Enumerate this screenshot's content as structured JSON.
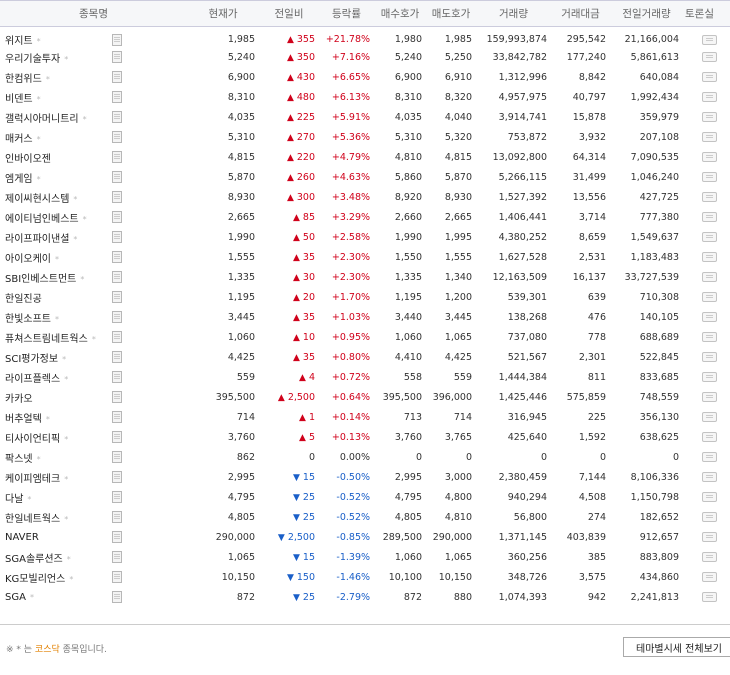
{
  "headers": {
    "name": "종목명",
    "price": "현재가",
    "change": "전일비",
    "rate": "등락률",
    "bid": "매수호가",
    "ask": "매도호가",
    "volume": "거래량",
    "amount": "거래대금",
    "prev_volume": "전일거래량",
    "talk": "토론실"
  },
  "rows": [
    {
      "name": "위지트",
      "star": "*",
      "price": "1,985",
      "dir": "up",
      "change": "355",
      "rate": "+21.78%",
      "bid": "1,980",
      "ask": "1,985",
      "volume": "159,993,874",
      "amount": "295,542",
      "prev": "21,166,004"
    },
    {
      "name": "우리기술투자",
      "star": "*",
      "price": "5,240",
      "dir": "up",
      "change": "350",
      "rate": "+7.16%",
      "bid": "5,240",
      "ask": "5,250",
      "volume": "33,842,782",
      "amount": "177,240",
      "prev": "5,861,613"
    },
    {
      "name": "한컴위드",
      "star": "*",
      "price": "6,900",
      "dir": "up",
      "change": "430",
      "rate": "+6.65%",
      "bid": "6,900",
      "ask": "6,910",
      "volume": "1,312,996",
      "amount": "8,842",
      "prev": "640,084"
    },
    {
      "name": "비덴트",
      "star": "*",
      "price": "8,310",
      "dir": "up",
      "change": "480",
      "rate": "+6.13%",
      "bid": "8,310",
      "ask": "8,320",
      "volume": "4,957,975",
      "amount": "40,797",
      "prev": "1,992,434"
    },
    {
      "name": "갤럭시아머니트리",
      "star": "*",
      "price": "4,035",
      "dir": "up",
      "change": "225",
      "rate": "+5.91%",
      "bid": "4,035",
      "ask": "4,040",
      "volume": "3,914,741",
      "amount": "15,878",
      "prev": "359,979"
    },
    {
      "name": "매커스",
      "star": "*",
      "price": "5,310",
      "dir": "up",
      "change": "270",
      "rate": "+5.36%",
      "bid": "5,310",
      "ask": "5,320",
      "volume": "753,872",
      "amount": "3,932",
      "prev": "207,108"
    },
    {
      "name": "인바이오젠",
      "star": "",
      "price": "4,815",
      "dir": "up",
      "change": "220",
      "rate": "+4.79%",
      "bid": "4,810",
      "ask": "4,815",
      "volume": "13,092,800",
      "amount": "64,314",
      "prev": "7,090,535"
    },
    {
      "name": "엠게임",
      "star": "*",
      "price": "5,870",
      "dir": "up",
      "change": "260",
      "rate": "+4.63%",
      "bid": "5,860",
      "ask": "5,870",
      "volume": "5,266,115",
      "amount": "31,499",
      "prev": "1,046,240"
    },
    {
      "name": "제이씨현시스템",
      "star": "*",
      "price": "8,930",
      "dir": "up",
      "change": "300",
      "rate": "+3.48%",
      "bid": "8,920",
      "ask": "8,930",
      "volume": "1,527,392",
      "amount": "13,556",
      "prev": "427,725"
    },
    {
      "name": "에이티넘인베스트",
      "star": "*",
      "price": "2,665",
      "dir": "up",
      "change": "85",
      "rate": "+3.29%",
      "bid": "2,660",
      "ask": "2,665",
      "volume": "1,406,441",
      "amount": "3,714",
      "prev": "777,380"
    },
    {
      "name": "라이프파이낸셜",
      "star": "*",
      "price": "1,990",
      "dir": "up",
      "change": "50",
      "rate": "+2.58%",
      "bid": "1,990",
      "ask": "1,995",
      "volume": "4,380,252",
      "amount": "8,659",
      "prev": "1,549,637"
    },
    {
      "name": "아이오케이",
      "star": "*",
      "price": "1,555",
      "dir": "up",
      "change": "35",
      "rate": "+2.30%",
      "bid": "1,550",
      "ask": "1,555",
      "volume": "1,627,528",
      "amount": "2,531",
      "prev": "1,183,483"
    },
    {
      "name": "SBI인베스트먼트",
      "star": "*",
      "price": "1,335",
      "dir": "up",
      "change": "30",
      "rate": "+2.30%",
      "bid": "1,335",
      "ask": "1,340",
      "volume": "12,163,509",
      "amount": "16,137",
      "prev": "33,727,539"
    },
    {
      "name": "한일진공",
      "star": "",
      "price": "1,195",
      "dir": "up",
      "change": "20",
      "rate": "+1.70%",
      "bid": "1,195",
      "ask": "1,200",
      "volume": "539,301",
      "amount": "639",
      "prev": "710,308"
    },
    {
      "name": "한빛소프트",
      "star": "*",
      "price": "3,445",
      "dir": "up",
      "change": "35",
      "rate": "+1.03%",
      "bid": "3,440",
      "ask": "3,445",
      "volume": "138,268",
      "amount": "476",
      "prev": "140,105"
    },
    {
      "name": "퓨쳐스트림네트웍스",
      "star": "*",
      "price": "1,060",
      "dir": "up",
      "change": "10",
      "rate": "+0.95%",
      "bid": "1,060",
      "ask": "1,065",
      "volume": "737,080",
      "amount": "778",
      "prev": "688,689"
    },
    {
      "name": "SCI평가정보",
      "star": "*",
      "price": "4,425",
      "dir": "up",
      "change": "35",
      "rate": "+0.80%",
      "bid": "4,410",
      "ask": "4,425",
      "volume": "521,567",
      "amount": "2,301",
      "prev": "522,845"
    },
    {
      "name": "라이프플렉스",
      "star": "*",
      "price": "559",
      "dir": "up",
      "change": "4",
      "rate": "+0.72%",
      "bid": "558",
      "ask": "559",
      "volume": "1,444,384",
      "amount": "811",
      "prev": "833,685"
    },
    {
      "name": "카카오",
      "star": "",
      "price": "395,500",
      "dir": "up",
      "change": "2,500",
      "rate": "+0.64%",
      "bid": "395,500",
      "ask": "396,000",
      "volume": "1,425,446",
      "amount": "575,859",
      "prev": "748,559"
    },
    {
      "name": "버추얼텍",
      "star": "*",
      "price": "714",
      "dir": "up",
      "change": "1",
      "rate": "+0.14%",
      "bid": "713",
      "ask": "714",
      "volume": "316,945",
      "amount": "225",
      "prev": "356,130"
    },
    {
      "name": "티사이언티픽",
      "star": "*",
      "price": "3,760",
      "dir": "up",
      "change": "5",
      "rate": "+0.13%",
      "bid": "3,760",
      "ask": "3,765",
      "volume": "425,640",
      "amount": "1,592",
      "prev": "638,625"
    },
    {
      "name": "팍스넷",
      "star": "*",
      "price": "862",
      "dir": "flat",
      "change": "0",
      "rate": "0.00%",
      "bid": "0",
      "ask": "0",
      "volume": "0",
      "amount": "0",
      "prev": "0"
    },
    {
      "name": "케이피엠테크",
      "star": "*",
      "price": "2,995",
      "dir": "down",
      "change": "15",
      "rate": "-0.50%",
      "bid": "2,995",
      "ask": "3,000",
      "volume": "2,380,459",
      "amount": "7,144",
      "prev": "8,106,336"
    },
    {
      "name": "다날",
      "star": "*",
      "price": "4,795",
      "dir": "down",
      "change": "25",
      "rate": "-0.52%",
      "bid": "4,795",
      "ask": "4,800",
      "volume": "940,294",
      "amount": "4,508",
      "prev": "1,150,798"
    },
    {
      "name": "한일네트웍스",
      "star": "*",
      "price": "4,805",
      "dir": "down",
      "change": "25",
      "rate": "-0.52%",
      "bid": "4,805",
      "ask": "4,810",
      "volume": "56,800",
      "amount": "274",
      "prev": "182,652"
    },
    {
      "name": "NAVER",
      "star": "",
      "price": "290,000",
      "dir": "down",
      "change": "2,500",
      "rate": "-0.85%",
      "bid": "289,500",
      "ask": "290,000",
      "volume": "1,371,145",
      "amount": "403,839",
      "prev": "912,657"
    },
    {
      "name": "SGA솔루션즈",
      "star": "*",
      "price": "1,065",
      "dir": "down",
      "change": "15",
      "rate": "-1.39%",
      "bid": "1,060",
      "ask": "1,065",
      "volume": "360,256",
      "amount": "385",
      "prev": "883,809"
    },
    {
      "name": "KG모빌리언스",
      "star": "*",
      "price": "10,150",
      "dir": "down",
      "change": "150",
      "rate": "-1.46%",
      "bid": "10,100",
      "ask": "10,150",
      "volume": "348,726",
      "amount": "3,575",
      "prev": "434,860"
    },
    {
      "name": "SGA",
      "star": "*",
      "price": "872",
      "dir": "down",
      "change": "25",
      "rate": "-2.79%",
      "bid": "872",
      "ask": "880",
      "volume": "1,074,393",
      "amount": "942",
      "prev": "2,241,813"
    }
  ],
  "footer": {
    "note_prefix": "※ * 는",
    "note_kosdaq": "코스닥",
    "note_suffix": "종목입니다.",
    "theme_button": "테마별시세 전체보기"
  },
  "colors": {
    "up": "#d0021b",
    "down": "#1a5fc8",
    "kosdaq": "#e28000"
  },
  "icons": {
    "doc": "document-icon",
    "talk": "speech-bubble-icon",
    "up": "triangle-up",
    "down": "triangle-down"
  }
}
